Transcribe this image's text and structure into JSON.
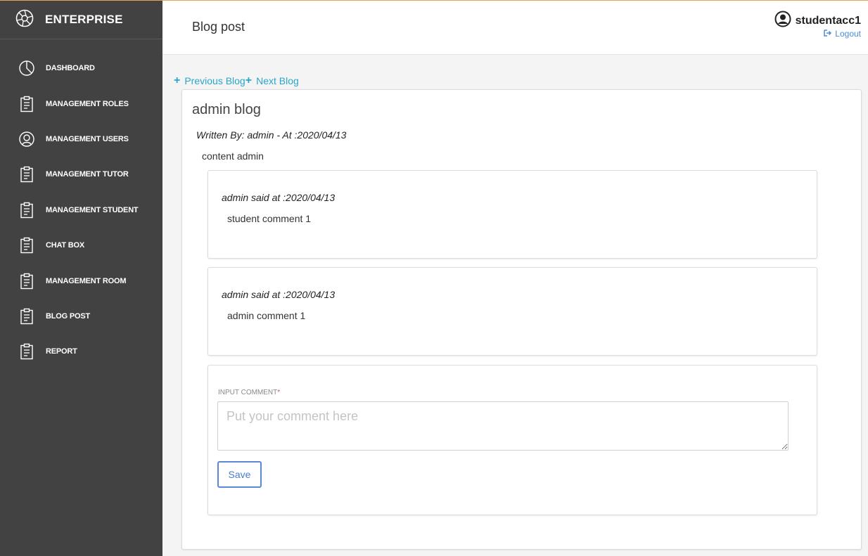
{
  "brand": {
    "name": "ENTERPRISE",
    "icon": "aperture-logo-icon"
  },
  "sidebar": {
    "items": [
      {
        "label": "DASHBOARD",
        "icon": "pie-chart-icon"
      },
      {
        "label": "MANAGEMENT ROLES",
        "icon": "clipboard-icon"
      },
      {
        "label": "MANAGEMENT USERS",
        "icon": "user-circle-icon"
      },
      {
        "label": "MANAGEMENT TUTOR",
        "icon": "clipboard-icon"
      },
      {
        "label": "MANAGEMENT STUDENT",
        "icon": "clipboard-icon"
      },
      {
        "label": "CHAT BOX",
        "icon": "clipboard-icon"
      },
      {
        "label": "MANAGEMENT ROOM",
        "icon": "clipboard-icon"
      },
      {
        "label": "BLOG POST",
        "icon": "clipboard-icon"
      },
      {
        "label": "REPORT",
        "icon": "clipboard-icon"
      }
    ]
  },
  "header": {
    "title": "Blog post",
    "username": "studentacc1",
    "logout_label": "Logout"
  },
  "blog_nav": {
    "previous_label": "Previous Blog",
    "next_label": "Next Blog",
    "plus_symbol": "+"
  },
  "blog": {
    "title": "admin blog",
    "written_by": "Written By: admin - At :2020/04/13",
    "content": "content admin"
  },
  "comments": [
    {
      "meta": "admin said at :2020/04/13",
      "text": "student comment 1"
    },
    {
      "meta": "admin said at :2020/04/13",
      "text": "admin comment 1"
    }
  ],
  "comment_form": {
    "label": "INPUT COMMENT",
    "required_mark": "*",
    "placeholder": "Put your comment here",
    "save_label": "Save"
  },
  "colors": {
    "sidebar_bg": "#424242",
    "accent_link": "#2aa6c9",
    "logout_link": "#4a8bd6",
    "save_border": "#5a88d6",
    "top_line": "#e8a25a"
  }
}
